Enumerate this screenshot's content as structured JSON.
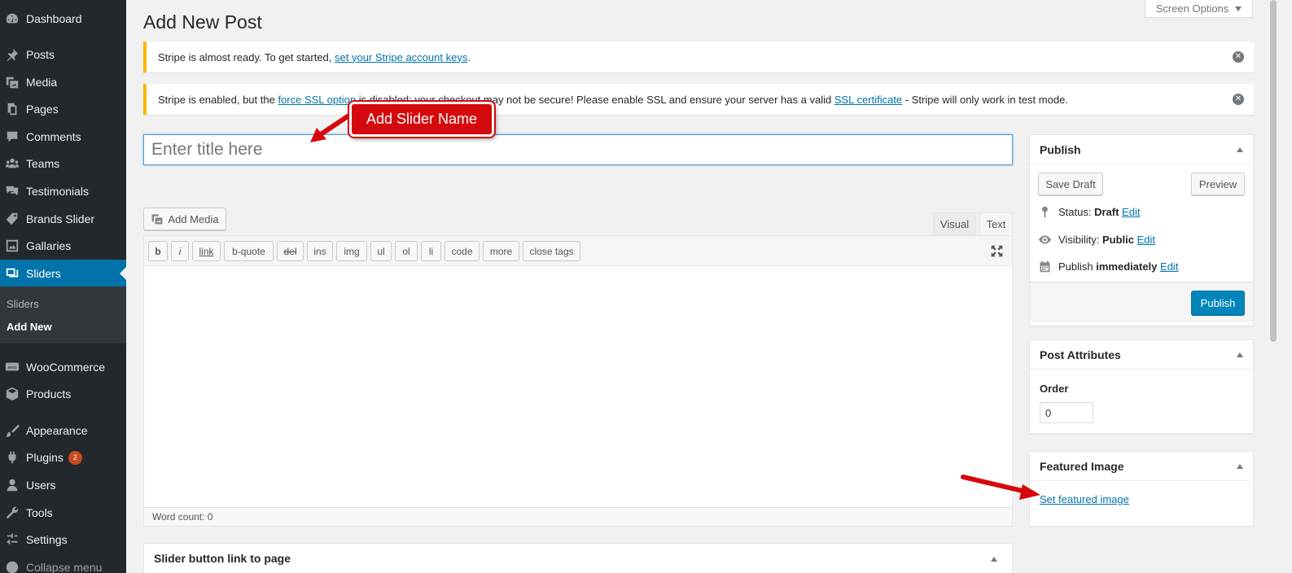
{
  "sidebar": {
    "items": [
      {
        "label": "Dashboard",
        "icon": "dashboard-icon"
      },
      {
        "label": "Posts",
        "icon": "pin-icon"
      },
      {
        "label": "Media",
        "icon": "media-icon"
      },
      {
        "label": "Pages",
        "icon": "pages-icon"
      },
      {
        "label": "Comments",
        "icon": "comment-icon"
      },
      {
        "label": "Teams",
        "icon": "groups-icon"
      },
      {
        "label": "Testimonials",
        "icon": "testimonial-icon"
      },
      {
        "label": "Brands Slider",
        "icon": "tag-icon"
      },
      {
        "label": "Gallaries",
        "icon": "gallery-icon"
      },
      {
        "label": "Sliders",
        "icon": "slides-icon"
      },
      {
        "label": "WooCommerce",
        "icon": "woo-icon"
      },
      {
        "label": "Products",
        "icon": "box-icon"
      },
      {
        "label": "Appearance",
        "icon": "brush-icon"
      },
      {
        "label": "Plugins",
        "icon": "plug-icon",
        "badge": "2"
      },
      {
        "label": "Users",
        "icon": "user-icon"
      },
      {
        "label": "Tools",
        "icon": "wrench-icon"
      },
      {
        "label": "Settings",
        "icon": "settings-icon"
      },
      {
        "label": "Collapse menu",
        "icon": "collapse-icon"
      }
    ],
    "submenu": {
      "all": "Sliders",
      "add_new": "Add New"
    }
  },
  "header": {
    "title": "Add New Post",
    "screen_options": "Screen Options"
  },
  "notices": [
    {
      "before": "Stripe is almost ready. To get started, ",
      "link": "set your Stripe account keys",
      "after": "."
    },
    {
      "before": "Stripe is enabled, but the ",
      "link": "force SSL option",
      "middle": " is disabled; your checkout may not be secure! Please enable SSL and ensure your server has a valid ",
      "link2": "SSL certificate",
      "after": " - Stripe will only work in test mode."
    }
  ],
  "editor": {
    "title_placeholder": "Enter title here",
    "add_media": "Add Media",
    "tab_visual": "Visual",
    "tab_text": "Text",
    "quicktags": [
      "b",
      "i",
      "link",
      "b-quote",
      "del",
      "ins",
      "img",
      "ul",
      "ol",
      "li",
      "code",
      "more",
      "close tags"
    ],
    "word_count": "Word count: 0"
  },
  "metabox_slider": {
    "title": "Slider button link to page"
  },
  "publish_box": {
    "title": "Publish",
    "save_draft": "Save Draft",
    "preview": "Preview",
    "status_label": "Status: ",
    "status_value": "Draft",
    "visibility_label": "Visibility: ",
    "visibility_value": "Public",
    "publish_label": "Publish ",
    "publish_value": "immediately",
    "edit": "Edit",
    "publish_button": "Publish"
  },
  "post_attributes": {
    "title": "Post Attributes",
    "order_label": "Order",
    "order_value": "0"
  },
  "featured_image": {
    "title": "Featured Image",
    "link": "Set featured image"
  },
  "annotations": {
    "callout": "Add Slider Name",
    "color": "#d4080d"
  },
  "colors": {
    "sidebar_bg": "#23282d",
    "active": "#0073aa",
    "notice_border": "#ffb900",
    "primary_button": "#0085ba"
  }
}
